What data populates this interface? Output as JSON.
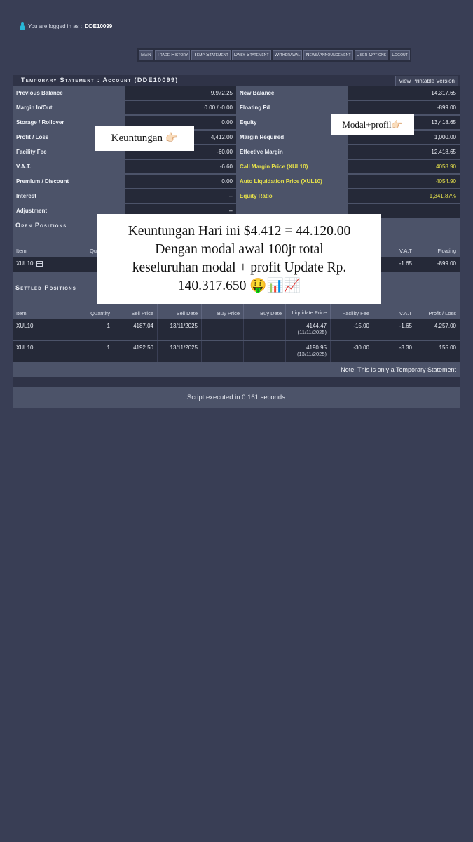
{
  "login": {
    "prefix": "You are logged in as :",
    "user": "DDE10099"
  },
  "nav": [
    "Main",
    "Trade History",
    "Temp Statement",
    "Daily Statement",
    "Withdrawal",
    "News/Announcement",
    "User Options",
    "Logout"
  ],
  "statement": {
    "title": "Temporary Statement : Account (DDE10099)",
    "printable": "View Printable Version",
    "left": [
      {
        "label": "Previous Balance",
        "value": "9,972.25"
      },
      {
        "label": "Margin In/Out",
        "value": "0.00 / -0.00"
      },
      {
        "label": "Storage / Rollover",
        "value": "0.00"
      },
      {
        "label": "Profit / Loss",
        "value": "4,412.00"
      },
      {
        "label": "Facility Fee",
        "value": "-60.00"
      },
      {
        "label": "V.A.T.",
        "value": "-6.60"
      },
      {
        "label": "Premium / Discount",
        "value": "0.00"
      },
      {
        "label": "Interest",
        "value": "--"
      },
      {
        "label": "Adjustment",
        "value": "--"
      }
    ],
    "right": [
      {
        "label": "New Balance",
        "value": "14,317.65"
      },
      {
        "label": "Floating P/L",
        "value": "-899.00"
      },
      {
        "label": "Equity",
        "value": "13,418.65"
      },
      {
        "label": "Margin Required",
        "value": "1,000.00"
      },
      {
        "label": "Effective Margin",
        "value": "12,418.65"
      },
      {
        "label": "Call Margin Price (XUL10)",
        "value": "4058.90"
      },
      {
        "label": "Auto Liquidation Price (XUL10)",
        "value": "4054.90"
      },
      {
        "label": "Equity Ratio",
        "value": "1,341.87%"
      }
    ]
  },
  "open_positions": {
    "title": "Open Positions",
    "headers": {
      "item": "Item",
      "quantity": "Quantity",
      "vat": "V.A.T",
      "floating": "Floating"
    },
    "row": {
      "item": "XUL10",
      "vat": "-1.65",
      "floating": "-899.00"
    }
  },
  "settled_positions": {
    "title": "Settled Positions",
    "headers": [
      "Item",
      "Quantity",
      "Sell Price",
      "Sell Date",
      "Buy Price",
      "Buy Date",
      "Liquidate Price",
      "Facility Fee",
      "V.A.T",
      "Profit / Loss"
    ],
    "rows": [
      {
        "item": "XUL10",
        "quantity": "1",
        "sell_price": "4187.04",
        "sell_date": "13/11/2025",
        "buy_price": "",
        "buy_date": "",
        "liq_price": "4144.47",
        "liq_date": "(11/11/2025)",
        "fee": "-15.00",
        "vat": "-1.65",
        "pl": "4,257.00"
      },
      {
        "item": "XUL10",
        "quantity": "1",
        "sell_price": "4192.50",
        "sell_date": "13/11/2025",
        "buy_price": "",
        "buy_date": "",
        "liq_price": "4190.95",
        "liq_date": "(13/11/2025)",
        "fee": "-30.00",
        "vat": "-3.30",
        "pl": "155.00"
      }
    ],
    "note": "Note: This is only a Temporary Statement"
  },
  "footer": {
    "script": "Script executed in 0.161 seconds"
  },
  "overlays": {
    "keuntungan": "Keuntungan 👉🏻",
    "modal_profit": "Modal+profil👉🏻",
    "caption_lines": [
      "Keuntungan Hari ini $4.412 = 44.120.00",
      "Dengan modal awal 100jt total",
      "keseluruhan modal + profit Update Rp.",
      "140.317.650 🤑📊📈"
    ]
  },
  "colors": {
    "background": "#393e55",
    "panel": "#4c5369",
    "cell_dark": "#252938",
    "highlight": "#e5e04b"
  }
}
